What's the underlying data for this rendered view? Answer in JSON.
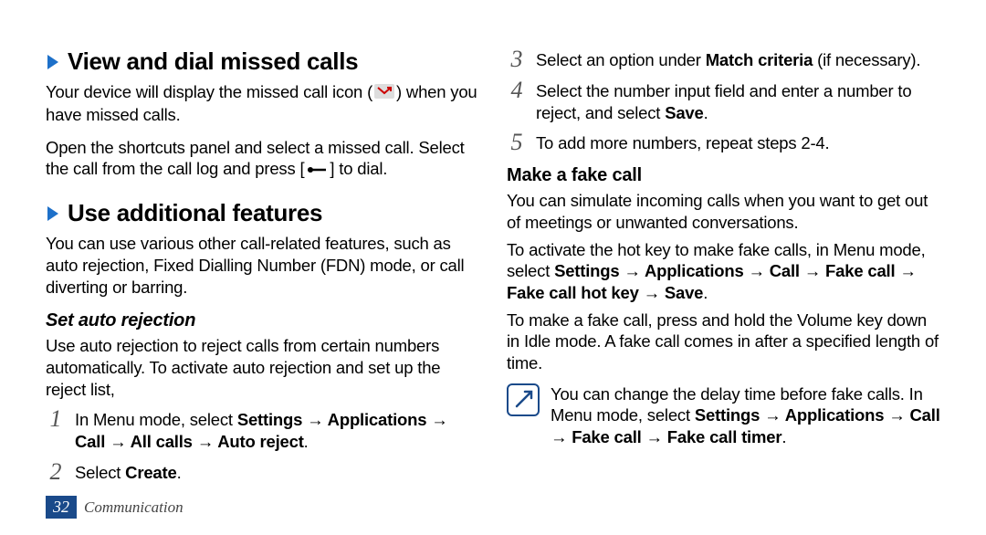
{
  "left": {
    "section1": {
      "title": "View and dial missed calls",
      "p1_a": "Your device will display the missed call icon (",
      "p1_b": ") when you have missed calls.",
      "p2_a": "Open the shortcuts panel and select a missed call. Select the call from the call log and press [",
      "p2_b": "] to dial."
    },
    "section2": {
      "title": "Use additional features",
      "p1": "You can use various other call-related features, such as auto rejection, Fixed Dialling Number (FDN) mode, or call diverting or barring.",
      "sub1": "Set auto rejection",
      "sub1p": "Use auto rejection to reject calls from certain numbers automatically. To activate auto rejection and set up the reject list,",
      "step1_a": "In Menu mode, select ",
      "step1_b": "Settings → Applications → Call → All calls → Auto reject",
      "step1_c": ".",
      "step2_a": "Select ",
      "step2_b": "Create",
      "step2_c": "."
    }
  },
  "right": {
    "step3_a": "Select an option under ",
    "step3_b": "Match criteria",
    "step3_c": " (if necessary).",
    "step4_a": "Select the number input field and enter a number to reject, and select ",
    "step4_b": "Save",
    "step4_c": ".",
    "step5": "To add more numbers, repeat steps 2-4.",
    "sub2": "Make a fake call",
    "sub2p1": "You can simulate incoming calls when you want to get out of meetings or unwanted conversations.",
    "sub2p2_a": "To activate the hot key to make fake calls, in Menu mode, select ",
    "sub2p2_b": "Settings → Applications → Call → Fake call → Fake call hot key → Save",
    "sub2p2_c": ".",
    "sub2p3": "To make a fake call, press and hold the Volume key down in Idle mode. A fake call comes in after a specified length of time.",
    "note_a": "You can change the delay time before fake calls. In Menu mode, select ",
    "note_b": "Settings → Applications → Call → Fake call → Fake call timer",
    "note_c": "."
  },
  "footer": {
    "page": "32",
    "label": "Communication"
  }
}
